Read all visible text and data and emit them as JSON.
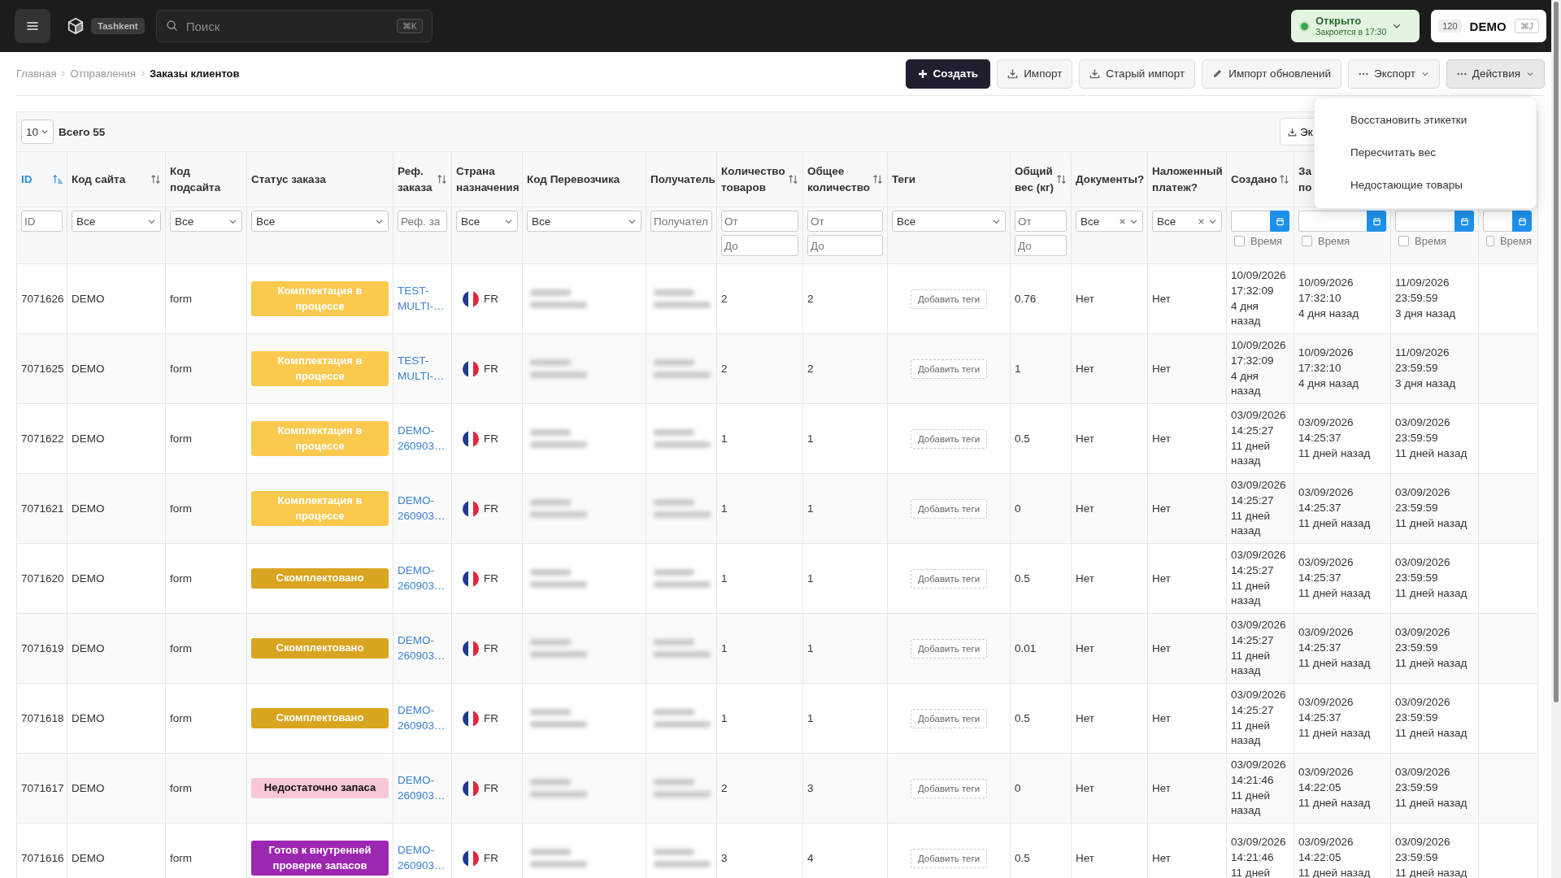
{
  "topbar": {
    "location": "Tashkent",
    "search": {
      "placeholder": "Поиск",
      "shortcut": "⌘K"
    },
    "store_status": {
      "label": "Открыто",
      "note": "Закроется в 17:30"
    },
    "account": {
      "count": "120",
      "name": "DEMO",
      "shortcut": "⌘J"
    }
  },
  "breadcrumbs": [
    {
      "label": "Главная",
      "current": false
    },
    {
      "label": "Отправления",
      "current": false
    },
    {
      "label": "Заказы клиентов",
      "current": true
    }
  ],
  "actions": [
    {
      "label": "Создать",
      "kind": "create"
    },
    {
      "label": "Импорт",
      "kind": "import"
    },
    {
      "label": "Старый импорт",
      "kind": "import"
    },
    {
      "label": "Импорт обновлений",
      "kind": "edit"
    },
    {
      "label": "Экспорт",
      "kind": "dropdown",
      "expanded": false
    },
    {
      "label": "Действия",
      "kind": "dropdown",
      "expanded": true
    }
  ],
  "actions_menu": {
    "items": [
      "Восстановить этикетки",
      "Пересчитать вес",
      "Недостающие товары"
    ]
  },
  "table_toolbar": {
    "page_size": "10",
    "total": "Всего 55",
    "export_button": "Эк"
  },
  "table": {
    "columns": [
      {
        "label": "ID",
        "sorted": true,
        "filter": {
          "kind": "text",
          "placeholder": "ID"
        }
      },
      {
        "label": "Код сайта",
        "sorted": false,
        "filter": {
          "kind": "select",
          "value": "Все",
          "clearable": false
        }
      },
      {
        "label": "Код подсайта",
        "filter": {
          "kind": "select",
          "value": "Все",
          "clearable": false
        }
      },
      {
        "label": "Статус заказа",
        "filter": {
          "kind": "select",
          "value": "Все",
          "clearable": false
        }
      },
      {
        "label": "Реф. заказа",
        "sorted": false,
        "filter": {
          "kind": "text",
          "placeholder": "Реф. за"
        }
      },
      {
        "label": "Страна назначения",
        "filter": {
          "kind": "select",
          "value": "Все",
          "clearable": false
        }
      },
      {
        "label": "Код Перевозчика",
        "filter": {
          "kind": "select",
          "value": "Все",
          "clearable": false
        }
      },
      {
        "label": "Получатель",
        "filter": {
          "kind": "text",
          "placeholder": "Получател"
        }
      },
      {
        "label": "Количество товаров",
        "sorted": false,
        "filter": {
          "kind": "range",
          "from": {
            "placeholder": "От"
          },
          "to": {
            "placeholder": "До"
          }
        }
      },
      {
        "label": "Общее количество",
        "sorted": false,
        "filter": {
          "kind": "range",
          "from": {
            "placeholder": "От"
          },
          "to": {
            "placeholder": "До"
          }
        }
      },
      {
        "label": "Теги",
        "filter": {
          "kind": "select",
          "value": "Все",
          "clearable": false
        }
      },
      {
        "label": "Общий вес (кг)",
        "sorted": false,
        "filter": {
          "kind": "range",
          "from": {
            "placeholder": "От"
          },
          "to": {
            "placeholder": "До"
          }
        }
      },
      {
        "label": "Документы?",
        "filter": {
          "kind": "select",
          "value": "Все",
          "clearable": true
        }
      },
      {
        "label": "Наложенный платеж?",
        "filter": {
          "kind": "select",
          "value": "Все",
          "clearable": true
        }
      },
      {
        "label": "Создано",
        "sorted": false,
        "filter": {
          "kind": "date",
          "checkbox": "Время",
          "checked": false
        }
      },
      {
        "label": "За\nпо",
        "filter": {
          "kind": "date",
          "checkbox": "Время",
          "checked": false
        }
      },
      {
        "filter": {
          "kind": "date",
          "checkbox": "Время",
          "checked": false
        }
      },
      {
        "filter": {
          "kind": "date",
          "checkbox": "Время",
          "checked": false
        }
      }
    ],
    "rows": [
      {
        "id": "7071626",
        "site": "DEMO",
        "subsite": "form",
        "status": {
          "label": "Комплектация в процессе",
          "color": "#fcc94f"
        },
        "ref": "TEST-MULTI-…",
        "country": "FR",
        "items": "2",
        "total": "2",
        "tags_button": "Добавить теги",
        "weight": "0.76",
        "documents": "Нет",
        "cod": "Нет",
        "created": {
          "date": "10/09/2026 17:32:09",
          "ago": "4 дня назад"
        },
        "column_16": {
          "date": "10/09/2026 17:32:10",
          "ago": "4 дня назад"
        },
        "column_17": {
          "date": "11/09/2026 23:59:59",
          "ago": "3 дня назад"
        }
      },
      {
        "id": "7071625",
        "site": "DEMO",
        "subsite": "form",
        "status": {
          "label": "Комплектация в процессе",
          "color": "#fcc94f"
        },
        "ref": "TEST-MULTI-…",
        "country": "FR",
        "items": "2",
        "total": "2",
        "tags_button": "Добавить теги",
        "weight": "1",
        "documents": "Нет",
        "cod": "Нет",
        "created": {
          "date": "10/09/2026 17:32:09",
          "ago": "4 дня назад"
        },
        "column_16": {
          "date": "10/09/2026 17:32:10",
          "ago": "4 дня назад"
        },
        "column_17": {
          "date": "11/09/2026 23:59:59",
          "ago": "3 дня назад"
        }
      },
      {
        "id": "7071622",
        "site": "DEMO",
        "subsite": "form",
        "status": {
          "label": "Комплектация в процессе",
          "color": "#fcc94f"
        },
        "ref": "DEMO-260903…",
        "country": "FR",
        "items": "1",
        "total": "1",
        "tags_button": "Добавить теги",
        "weight": "0.5",
        "documents": "Нет",
        "cod": "Нет",
        "created": {
          "date": "03/09/2026 14:25:27",
          "ago": "11 дней назад"
        },
        "column_16": {
          "date": "03/09/2026 14:25:37",
          "ago": "11 дней назад"
        },
        "column_17": {
          "date": "03/09/2026 23:59:59",
          "ago": "11 дней назад"
        }
      },
      {
        "id": "7071621",
        "site": "DEMO",
        "subsite": "form",
        "status": {
          "label": "Комплектация в процессе",
          "color": "#fcc94f"
        },
        "ref": "DEMO-260903…",
        "country": "FR",
        "items": "1",
        "total": "1",
        "tags_button": "Добавить теги",
        "weight": "0",
        "documents": "Нет",
        "cod": "Нет",
        "created": {
          "date": "03/09/2026 14:25:27",
          "ago": "11 дней назад"
        },
        "column_16": {
          "date": "03/09/2026 14:25:37",
          "ago": "11 дней назад"
        },
        "column_17": {
          "date": "03/09/2026 23:59:59",
          "ago": "11 дней назад"
        }
      },
      {
        "id": "7071620",
        "site": "DEMO",
        "subsite": "form",
        "status": {
          "label": "Скомплектовано",
          "color": "#d9a520"
        },
        "ref": "DEMO-260903…",
        "country": "FR",
        "items": "1",
        "total": "1",
        "tags_button": "Добавить теги",
        "weight": "0.5",
        "documents": "Нет",
        "cod": "Нет",
        "created": {
          "date": "03/09/2026 14:25:27",
          "ago": "11 дней назад"
        },
        "column_16": {
          "date": "03/09/2026 14:25:37",
          "ago": "11 дней назад"
        },
        "column_17": {
          "date": "03/09/2026 23:59:59",
          "ago": "11 дней назад"
        }
      },
      {
        "id": "7071619",
        "site": "DEMO",
        "subsite": "form",
        "status": {
          "label": "Скомплектовано",
          "color": "#d9a520"
        },
        "ref": "DEMO-260903…",
        "country": "FR",
        "items": "1",
        "total": "1",
        "tags_button": "Добавить теги",
        "weight": "0.01",
        "documents": "Нет",
        "cod": "Нет",
        "created": {
          "date": "03/09/2026 14:25:27",
          "ago": "11 дней назад"
        },
        "column_16": {
          "date": "03/09/2026 14:25:37",
          "ago": "11 дней назад"
        },
        "column_17": {
          "date": "03/09/2026 23:59:59",
          "ago": "11 дней назад"
        }
      },
      {
        "id": "7071618",
        "site": "DEMO",
        "subsite": "form",
        "status": {
          "label": "Скомплектовано",
          "color": "#d9a520"
        },
        "ref": "DEMO-260903…",
        "country": "FR",
        "items": "1",
        "total": "1",
        "tags_button": "Добавить теги",
        "weight": "0.5",
        "documents": "Нет",
        "cod": "Нет",
        "created": {
          "date": "03/09/2026 14:25:27",
          "ago": "11 дней назад"
        },
        "column_16": {
          "date": "03/09/2026 14:25:37",
          "ago": "11 дней назад"
        },
        "column_17": {
          "date": "03/09/2026 23:59:59",
          "ago": "11 дней назад"
        }
      },
      {
        "id": "7071617",
        "site": "DEMO",
        "subsite": "form",
        "status": {
          "label": "Недостаточно запаса",
          "color": "#f8c8d8"
        },
        "ref": "DEMO-260903…",
        "country": "FR",
        "items": "2",
        "total": "3",
        "tags_button": "Добавить теги",
        "weight": "0",
        "documents": "Нет",
        "cod": "Нет",
        "created": {
          "date": "03/09/2026 14:21:46",
          "ago": "11 дней назад"
        },
        "column_16": {
          "date": "03/09/2026 14:22:05",
          "ago": "11 дней назад"
        },
        "column_17": {
          "date": "03/09/2026 23:59:59",
          "ago": "11 дней назад"
        }
      },
      {
        "id": "7071616",
        "site": "DEMO",
        "subsite": "form",
        "status": {
          "label": "Готов к внутренней проверке запасов",
          "color": "#9c27b0"
        },
        "ref": "DEMO-260903…",
        "country": "FR",
        "items": "3",
        "total": "4",
        "tags_button": "Добавить теги",
        "weight": "0.5",
        "documents": "Нет",
        "cod": "Нет",
        "created": {
          "date": "03/09/2026 14:21:46",
          "ago": "11 дней"
        },
        "column_16": {
          "date": "03/09/2026 14:22:05",
          "ago": "11 дней назад"
        },
        "column_17": {
          "date": "03/09/2026 23:59:59",
          "ago": "11 дней назад"
        }
      }
    ]
  }
}
